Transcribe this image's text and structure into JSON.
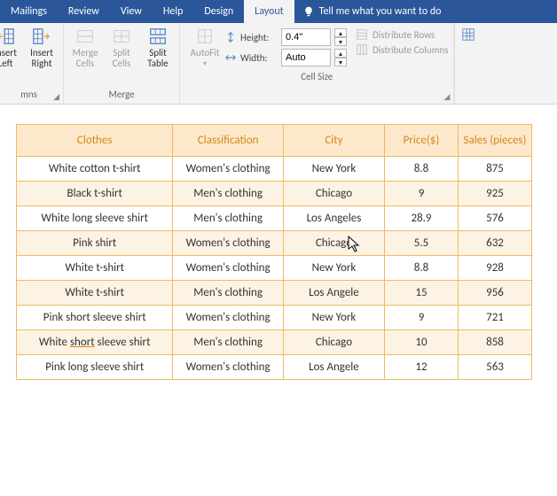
{
  "tabs": {
    "mailings": "Mailings",
    "review": "Review",
    "view": "View",
    "help": "Help",
    "design": "Design",
    "layout": "Layout",
    "tellme": "Tell me what you want to do"
  },
  "ribbon": {
    "rows_cols": {
      "insert_left": "Insert\nLeft",
      "insert_right": "Insert\nRight",
      "group_label": "mns"
    },
    "merge": {
      "merge_cells": "Merge\nCells",
      "split_cells": "Split\nCells",
      "split_table": "Split\nTable",
      "group_label": "Merge"
    },
    "autofit": "AutoFit",
    "cell_size": {
      "height_label": "Height:",
      "height_value": "0.4\"",
      "width_label": "Width:",
      "width_value": "Auto",
      "dist_rows": "Distribute Rows",
      "dist_cols": "Distribute Columns",
      "group_label": "Cell Size"
    }
  },
  "table": {
    "headers": [
      "Clothes",
      "Classification",
      "City",
      "Price($)",
      "Sales (pieces)"
    ],
    "rows": [
      [
        "White cotton t-shirt",
        "Women's clothing",
        "New York",
        "8.8",
        "875"
      ],
      [
        "Black t-shirt",
        "Men's clothing",
        "Chicago",
        "9",
        "925"
      ],
      [
        "White long sleeve shirt",
        "Men's clothing",
        "Los Angeles",
        "28.9",
        "576"
      ],
      [
        "Pink shirt",
        "Women's clothing",
        "Chicago",
        "5.5",
        "632"
      ],
      [
        "White t-shirt",
        "Women's clothing",
        "New York",
        "8.8",
        "928"
      ],
      [
        "White t-shirt",
        "Men's clothing",
        "Los Angele",
        "15",
        "956"
      ],
      [
        "Pink short sleeve shirt",
        "Women's clothing",
        "New York",
        "9",
        "721"
      ],
      [
        "White short sleeve shirt",
        "Men's clothing",
        "Chicago",
        "10",
        "858"
      ],
      [
        "Pink long sleeve shirt",
        "Women's clothing",
        "Los Angele",
        "12",
        "563"
      ]
    ]
  }
}
